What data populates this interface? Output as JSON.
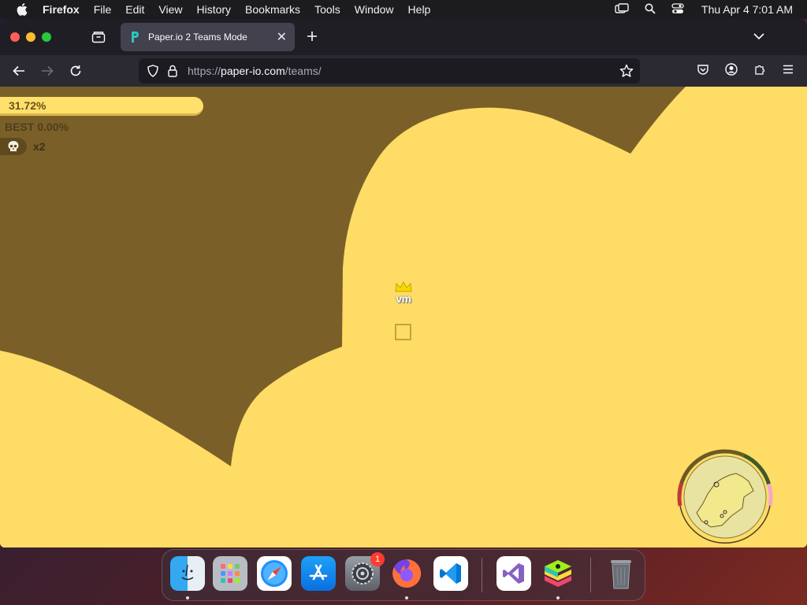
{
  "menubar": {
    "app_name": "Firefox",
    "items": [
      "File",
      "Edit",
      "View",
      "History",
      "Bookmarks",
      "Tools",
      "Window",
      "Help"
    ],
    "clock": "Thu Apr 4  7:01 AM"
  },
  "browser": {
    "tab_title": "Paper.io 2 Teams Mode",
    "url_prefix": "https://",
    "url_host": "paper-io.com",
    "url_path": "/teams/"
  },
  "game": {
    "territory_percent": "31.72%",
    "best_label": "BEST 0.00%",
    "kills_label": "x2",
    "player_name": "vm",
    "colors": {
      "territory": "#ffdc66",
      "background_field": "#7a6028",
      "minimap_segments": [
        "#6b5a24",
        "#3d5a2a",
        "#f7a8c8",
        "#c13a3a"
      ]
    }
  },
  "dock": {
    "apps": [
      "finder",
      "launchpad",
      "safari",
      "app-store",
      "system-settings",
      "firefox",
      "vscode",
      "visual-studio",
      "bluestacks",
      "trash"
    ],
    "settings_badge": "1"
  }
}
